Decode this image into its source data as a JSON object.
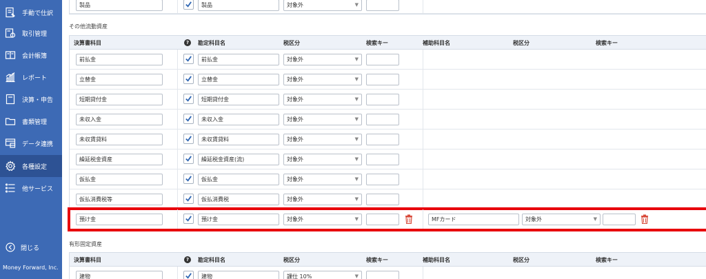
{
  "sidebar": {
    "items": [
      {
        "label": "手動で仕訳",
        "icon": "journal-icon"
      },
      {
        "label": "取引管理",
        "icon": "transaction-icon"
      },
      {
        "label": "会計帳簿",
        "icon": "ledger-icon"
      },
      {
        "label": "レポート",
        "icon": "report-chart-icon"
      },
      {
        "label": "決算・申告",
        "icon": "settlement-icon"
      },
      {
        "label": "書類管理",
        "icon": "folder-icon"
      },
      {
        "label": "データ連携",
        "icon": "data-link-icon"
      },
      {
        "label": "各種設定",
        "icon": "gear-icon"
      },
      {
        "label": "他サービス",
        "icon": "list-icon"
      }
    ],
    "close_label": "閉じる",
    "footer": "Money Forward, Inc."
  },
  "top_partial_row": {
    "name": "製品",
    "account": "製品",
    "tax": "対象外",
    "checked": true
  },
  "sections": [
    {
      "title": "その他流動資産",
      "headers": {
        "col1": "決算書科目",
        "help": "?",
        "col2": "勘定科目名",
        "col3": "税区分",
        "col4": "検索キー",
        "col5": "補助科目名",
        "col6": "税区分",
        "col7": "検索キー"
      },
      "rows": [
        {
          "name": "前払金",
          "account": "前払金",
          "tax": "対象外",
          "search": "",
          "checked": true
        },
        {
          "name": "立替金",
          "account": "立替金",
          "tax": "対象外",
          "search": "",
          "checked": true
        },
        {
          "name": "短期貸付金",
          "account": "短期貸付金",
          "tax": "対象外",
          "search": "",
          "checked": true
        },
        {
          "name": "未収入金",
          "account": "未収入金",
          "tax": "対象外",
          "search": "",
          "checked": true
        },
        {
          "name": "未収賃貸料",
          "account": "未収賃貸料",
          "tax": "対象外",
          "search": "",
          "checked": true
        },
        {
          "name": "繰延税金資産",
          "account": "繰延税金資産(流)",
          "tax": "対象外",
          "search": "",
          "checked": true
        },
        {
          "name": "仮払金",
          "account": "仮払金",
          "tax": "対象外",
          "search": "",
          "checked": true
        },
        {
          "name": "仮払消費税等",
          "account": "仮払消費税",
          "tax": "対象外",
          "search": "",
          "checked": true
        },
        {
          "name": "預け金",
          "account": "預け金",
          "tax": "対象外",
          "search": "",
          "checked": true,
          "sub_name": "MFカード",
          "sub_tax": "対象外",
          "sub_search": ""
        }
      ]
    },
    {
      "title": "有形固定資産",
      "headers": {
        "col1": "決算書科目",
        "help": "?",
        "col2": "勘定科目名",
        "col3": "税区分",
        "col4": "検索キー",
        "col5": "補助科目名",
        "col6": "税区分",
        "col7": "検索キー"
      },
      "rows": [
        {
          "name": "建物",
          "account": "建物",
          "tax": "課仕 10%",
          "checked": true
        }
      ]
    }
  ],
  "colors": {
    "sidebar_bg": "#3d6ab5",
    "sidebar_active": "#2d5294",
    "highlight": "#e8000b",
    "check": "#2f66b3",
    "trash": "#d84a3a"
  }
}
